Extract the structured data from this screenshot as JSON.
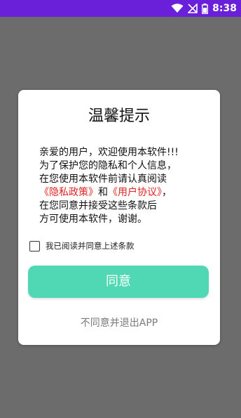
{
  "status_bar": {
    "time": "8:38",
    "background": "#6a1fd8",
    "icons": [
      "wifi-icon",
      "signal-blocked-icon",
      "battery-icon"
    ]
  },
  "dialog": {
    "title": "温馨提示",
    "body": {
      "line1": "亲爱的用户，欢迎使用本软件!!!",
      "line2": "为了保护您的隐私和个人信息，",
      "line3": "在您使用本软件前请认真阅读",
      "privacy_link": "《隐私政策》",
      "conjunction": "和",
      "agreement_link": "《用户协议》",
      "line4_tail": "，",
      "line5": "在您同意并接受这些条款后",
      "line6": "方可使用本软件，谢谢。"
    },
    "checkbox_label": "我已阅读并同意上述条款",
    "checkbox_checked": false,
    "agree_button": "同意",
    "exit_link": "不同意并退出APP"
  },
  "colors": {
    "accent": "#4fd8b3",
    "link": "#e02424",
    "overlay": "#6c6c6c"
  }
}
